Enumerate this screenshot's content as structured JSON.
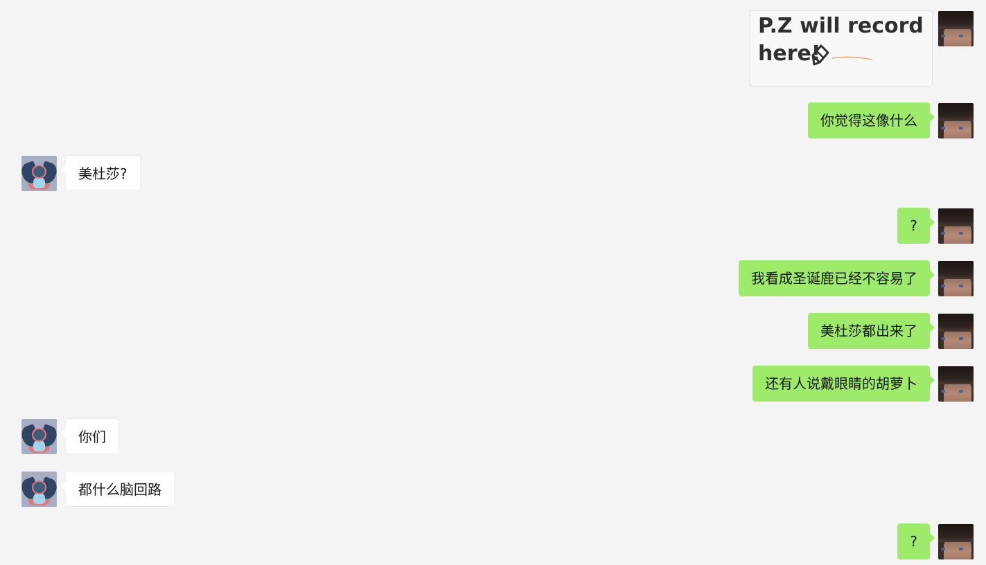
{
  "chat": {
    "messages": [
      {
        "sender": "me",
        "type": "image",
        "image_text": "P.Z will record\nhere!",
        "icon": "pen-icon"
      },
      {
        "sender": "me",
        "type": "text",
        "text": "你觉得这像什么"
      },
      {
        "sender": "other",
        "type": "text",
        "text": "美杜莎?"
      },
      {
        "sender": "me",
        "type": "text",
        "text": "?"
      },
      {
        "sender": "me",
        "type": "text",
        "text": "我看成圣诞鹿已经不容易了"
      },
      {
        "sender": "me",
        "type": "text",
        "text": "美杜莎都出来了"
      },
      {
        "sender": "me",
        "type": "text",
        "text": "还有人说戴眼睛的胡萝卜"
      },
      {
        "sender": "other",
        "type": "text",
        "text": "你们"
      },
      {
        "sender": "other",
        "type": "text",
        "text": "都什么脑回路"
      },
      {
        "sender": "me",
        "type": "text",
        "text": "?"
      }
    ]
  },
  "colors": {
    "background": "#f4f4f4",
    "my_bubble": "#9eea6a",
    "other_bubble": "#ffffff",
    "text": "#191919"
  }
}
